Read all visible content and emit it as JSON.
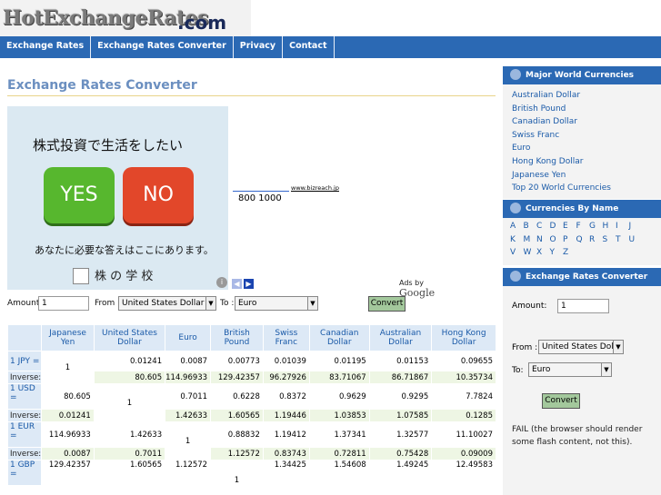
{
  "logo": {
    "text": "HotExchangeRates",
    "suffix": ".com"
  },
  "nav": [
    "Exchange Rates",
    "Exchange Rates Converter",
    "Privacy",
    "Contact"
  ],
  "page_title": "Exchange Rates Converter",
  "ad1": {
    "headline": "株式投資で生活をしたい",
    "yes": "YES",
    "no": "NO",
    "tagline": "あなたに必要な答えはここにあります。",
    "school": "株 の 学 校"
  },
  "ad2": {
    "link": "www.bizreach.jp",
    "numbers": "800  1000",
    "ads_by": "Ads by",
    "google": "Google"
  },
  "converter": {
    "amount_label": "Amount:",
    "amount_value": "1",
    "from_label": "From :",
    "from_value": "United States Dollar",
    "to_label": "To :",
    "to_value": "Euro",
    "button": "Convert"
  },
  "table": {
    "headers": [
      "Japanese Yen",
      "United States Dollar",
      "Euro",
      "British Pound",
      "Swiss Franc",
      "Canadian Dollar",
      "Australian Dollar",
      "Hong Kong Dollar"
    ],
    "rows": [
      {
        "label": "1 JPY =",
        "values": [
          "1",
          "0.01241",
          "0.0087",
          "0.00773",
          "0.01039",
          "0.01195",
          "0.01153",
          "0.09655"
        ],
        "inverse": [
          "",
          "80.605",
          "114.96933",
          "129.42357",
          "96.27926",
          "83.71067",
          "86.71867",
          "10.35734"
        ]
      },
      {
        "label": "1 USD =",
        "values": [
          "80.605",
          "1",
          "0.7011",
          "0.6228",
          "0.8372",
          "0.9629",
          "0.9295",
          "7.7824"
        ],
        "inverse": [
          "0.01241",
          "",
          "1.42633",
          "1.60565",
          "1.19446",
          "1.03853",
          "1.07585",
          "0.1285"
        ]
      },
      {
        "label": "1 EUR =",
        "values": [
          "114.96933",
          "1.42633",
          "1",
          "0.88832",
          "1.19412",
          "1.37341",
          "1.32577",
          "11.10027"
        ],
        "inverse": [
          "0.0087",
          "0.7011",
          "",
          "1.12572",
          "0.83743",
          "0.72811",
          "0.75428",
          "0.09009"
        ]
      },
      {
        "label": "1 GBP =",
        "values": [
          "129.42357",
          "1.60565",
          "1.12572",
          "1",
          "1.34425",
          "1.54608",
          "1.49245",
          "12.49583"
        ],
        "inverse": []
      }
    ],
    "inverse_label": "Inverse:"
  },
  "sidebar": {
    "major_title": "Major World Currencies",
    "major_links": [
      "Australian Dollar",
      "British Pound",
      "Canadian Dollar",
      "Swiss Franc",
      "Euro",
      "Hong Kong Dollar",
      "Japanese Yen",
      "Top 20 World Currencies"
    ],
    "byname_title": "Currencies By Name",
    "letters": [
      "A",
      "B",
      "C",
      "D",
      "E",
      "F",
      "G",
      "H",
      "I",
      "J",
      "K",
      "M",
      "N",
      "O",
      "P",
      "Q",
      "R",
      "S",
      "T",
      "U",
      "V",
      "W",
      "X",
      "Y",
      "Z"
    ],
    "conv_title": "Exchange Rates Converter",
    "amount_label": "Amount:",
    "amount_value": "1",
    "from_label": "From :",
    "from_value": "United States Doll",
    "to_label": "To:",
    "to_value": "Euro",
    "button": "Convert",
    "fail_text": "FAIL (the browser should render some flash content, not this)."
  },
  "colors": {
    "nav": "#2b69b4",
    "title": "#6b8fc0",
    "link": "#1a5aa8",
    "convert_button": "#a3c89c"
  }
}
